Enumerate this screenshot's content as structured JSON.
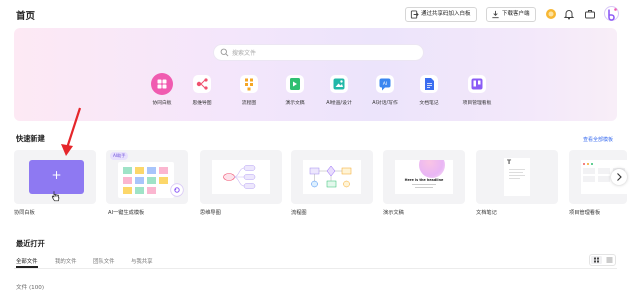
{
  "header": {
    "title": "首页",
    "join_whiteboard_label": "通过共享码加入白板",
    "download_client_label": "下载客户端"
  },
  "search": {
    "placeholder": "搜索文件"
  },
  "tools": [
    {
      "label": "协同白板",
      "icon": "whiteboard-icon",
      "color": "#f05bb0"
    },
    {
      "label": "思维导图",
      "icon": "mindmap-icon",
      "color": "#f0506e"
    },
    {
      "label": "流程图",
      "icon": "flowchart-icon",
      "color": "#f5a623"
    },
    {
      "label": "演示文稿",
      "icon": "presentation-icon",
      "color": "#2fbf71"
    },
    {
      "label": "AI绘画/设计",
      "icon": "ai-drawing-icon",
      "color": "#22b8a8"
    },
    {
      "label": "AI对话/写作",
      "icon": "ai-chat-icon",
      "color": "#3a86f0"
    },
    {
      "label": "文档笔记",
      "icon": "document-icon",
      "color": "#3a6df0"
    },
    {
      "label": "项目管理看板",
      "icon": "kanban-icon",
      "color": "#8b5cf6"
    }
  ],
  "quick_create": {
    "title": "快速新建",
    "view_all_label": "查看全部模板",
    "new_plus": "+",
    "ai_badge": "AI助手",
    "presentation_thumb_text": "Here is the headline",
    "cards": [
      {
        "label": "协同白板"
      },
      {
        "label": "AI一键生成模板"
      },
      {
        "label": "思维导图"
      },
      {
        "label": "流程图"
      },
      {
        "label": "演示文稿"
      },
      {
        "label": "文档笔记"
      },
      {
        "label": "项目管理看板"
      }
    ]
  },
  "recent": {
    "title": "最近打开",
    "tabs": [
      "全部文件",
      "我的文件",
      "团队文件",
      "与我共享"
    ],
    "files_count": "文件 (100)"
  },
  "colors": {
    "accent_purple": "#8e79f2",
    "annotation_red": "#e5262b",
    "link_blue": "#3a6df0"
  }
}
